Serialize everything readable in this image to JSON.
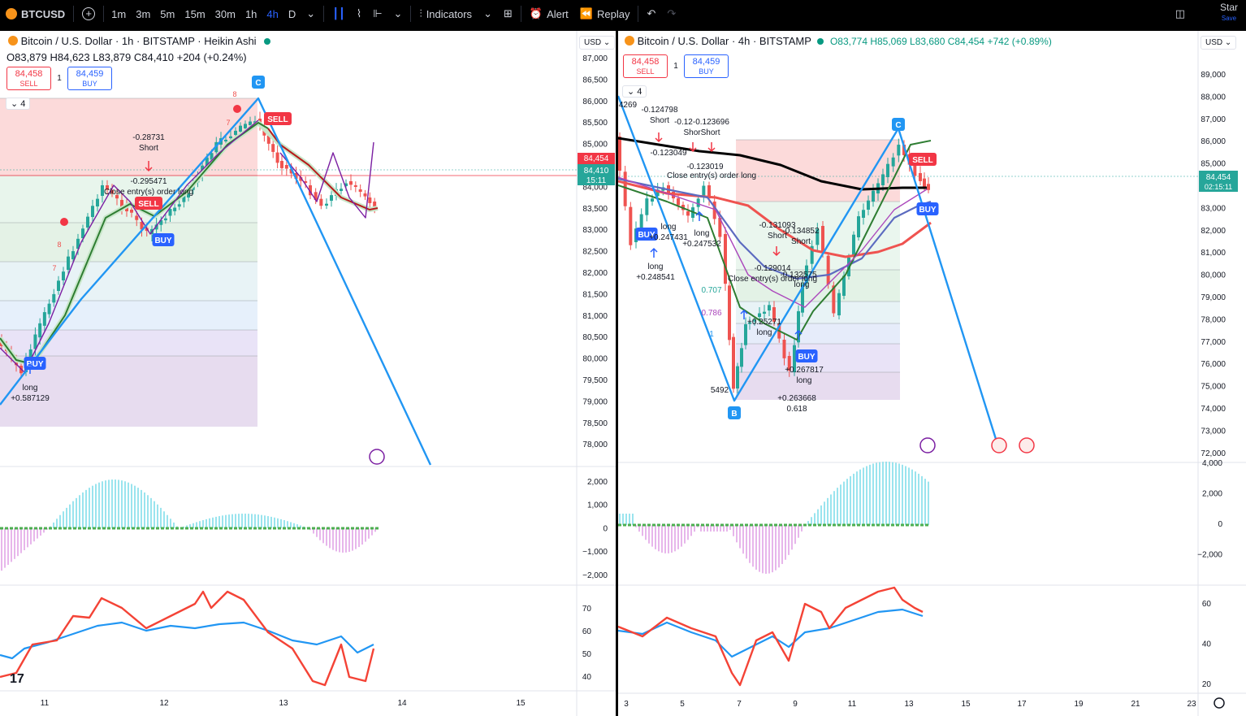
{
  "topbar": {
    "symbol": "BTCUSD",
    "timeframes": [
      "1m",
      "3m",
      "5m",
      "15m",
      "30m",
      "1h",
      "4h",
      "D"
    ],
    "active_timeframe": "4h",
    "indicators_label": "Indicators",
    "alert_label": "Alert",
    "replay_label": "Replay",
    "star_label": "Star",
    "save_label": "Save"
  },
  "left": {
    "title": "Bitcoin / U.S. Dollar · 1h · BITSTAMP · Heikin Ashi",
    "ohlc": "O83,879 H84,623 L83,879 C84,410 +204 (+0.24%)",
    "sell_price": "84,458",
    "sell_label": "SELL",
    "qty": "1",
    "buy_price": "84,459",
    "buy_label": "BUY",
    "currency": "USD",
    "indicator_count": "4",
    "price_ticks": [
      "87,000",
      "86,500",
      "86,000",
      "85,500",
      "85,000",
      "84,500",
      "84,000",
      "83,500",
      "83,000",
      "82,500",
      "82,000",
      "81,500",
      "81,000",
      "80,500",
      "80,000",
      "79,500",
      "79,000",
      "78,500",
      "78,000"
    ],
    "last_price": "84,454",
    "cur_price": "84,410",
    "countdown": "15:11",
    "macd_ticks": [
      "2,000",
      "1,000",
      "0",
      "−1,000",
      "−2,000"
    ],
    "rsi_ticks": [
      "70",
      "60",
      "50",
      "40"
    ],
    "time_ticks": [
      "11",
      "12",
      "13",
      "14",
      "15"
    ],
    "labels": [
      {
        "t": "-0.28731"
      },
      {
        "t": "Short"
      },
      {
        "t": "-0.295471"
      },
      {
        "t": "Close entry(s) order long"
      },
      {
        "t": "long"
      },
      {
        "t": "+0.587129"
      },
      {
        "t": "8"
      },
      {
        "t": "7"
      },
      {
        "t": "8"
      },
      {
        "t": "7"
      }
    ],
    "badges": {
      "c": "C",
      "sell": "SELL",
      "buy1": "BUY",
      "buy2": "BUY"
    }
  },
  "right": {
    "title": "Bitcoin / U.S. Dollar · 4h · BITSTAMP",
    "ohlc": "O83,774 H85,069 L83,680 C84,454 +742 (+0.89%)",
    "sell_price": "84,458",
    "sell_label": "SELL",
    "qty": "1",
    "buy_price": "84,459",
    "buy_label": "BUY",
    "currency": "USD",
    "indicator_count": "4",
    "price_ticks": [
      "89,000",
      "88,000",
      "87,000",
      "86,000",
      "85,000",
      "84,000",
      "83,000",
      "82,000",
      "81,000",
      "80,000",
      "79,000",
      "78,000",
      "77,000",
      "76,000",
      "75,000",
      "74,000",
      "73,000",
      "72,000"
    ],
    "last_price": "84,454",
    "countdown": "02:15:11",
    "macd_ticks": [
      "4,000",
      "2,000",
      "0",
      "−2,000"
    ],
    "rsi_ticks": [
      "60",
      "40",
      "20"
    ],
    "time_ticks": [
      "3",
      "5",
      "7",
      "9",
      "11",
      "13",
      "15",
      "17",
      "19",
      "21",
      "23"
    ],
    "labels": [
      {
        "t": "-0.124798"
      },
      {
        "t": "Short"
      },
      {
        "t": "-0.12-0.123696"
      },
      {
        "t": "ShorShort"
      },
      {
        "t": "-0.123049"
      },
      {
        "t": "-0.123019"
      },
      {
        "t": "Close entry(s) order long"
      },
      {
        "t": "long"
      },
      {
        "t": "+0.247431"
      },
      {
        "t": "long"
      },
      {
        "t": "+0.247532"
      },
      {
        "t": "long"
      },
      {
        "t": "+0.248541"
      },
      {
        "t": "-0.131093"
      },
      {
        "t": "Short"
      },
      {
        "t": "-0.134852"
      },
      {
        "t": "Short"
      },
      {
        "t": "-0.129014"
      },
      {
        "t": "-0.132575"
      },
      {
        "t": "Close entry(s) order long"
      },
      {
        "t": "long"
      },
      {
        "t": "+0.25271"
      },
      {
        "t": "long"
      },
      {
        "t": "+0.267817"
      },
      {
        "t": "long"
      },
      {
        "t": "+0.263668"
      },
      {
        "t": "0.618"
      },
      {
        "t": "0.707"
      },
      {
        "t": "0.786"
      },
      {
        "t": "1"
      },
      {
        "t": "5492"
      },
      {
        "t": "4269"
      }
    ],
    "badges": {
      "c": "C",
      "b": "B",
      "sell": "SELL",
      "buy": "BUY"
    }
  },
  "colors": {
    "up": "#26a69a",
    "down": "#ef5350",
    "blue": "#2196f3",
    "accent": "#2962ff",
    "sell": "#f23645",
    "fib_red": "#fbd6d6",
    "fib_green": "#e6f4ea"
  }
}
